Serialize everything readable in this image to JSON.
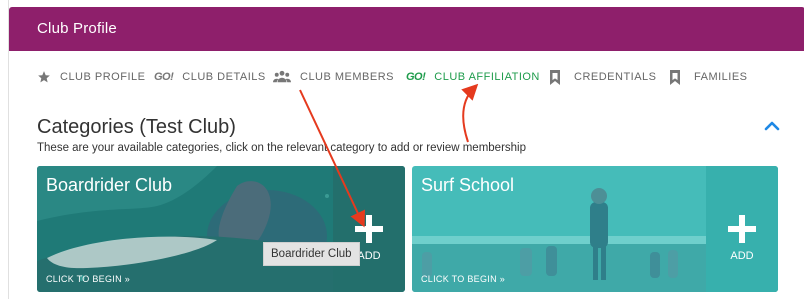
{
  "header": {
    "title": "Club Profile"
  },
  "nav": {
    "items": [
      {
        "label": "CLUB PROFILE",
        "icon": "star-icon"
      },
      {
        "label": "CLUB DETAILS",
        "icon": "go-icon"
      },
      {
        "label": "CLUB MEMBERS",
        "icon": "people-icon"
      },
      {
        "label": "CLUB AFFILIATION",
        "icon": "go-icon",
        "active": true
      },
      {
        "label": "CREDENTIALS",
        "icon": "bookmark-icon"
      },
      {
        "label": "FAMILIES",
        "icon": "bookmark-icon"
      }
    ],
    "go_text": "GO!"
  },
  "section": {
    "title": "Categories (Test Club)",
    "subtitle": "These are your available categories, click on the relevant category to add or review membership"
  },
  "cards": [
    {
      "title": "Boardrider Club",
      "begin": "CLICK TO BEGIN »",
      "add": "ADD",
      "tint": "#1f7a77",
      "pane": "#236f6c"
    },
    {
      "title": "Surf School",
      "begin": "CLICK TO BEGIN »",
      "add": "ADD",
      "tint": "#3fbab8",
      "pane": "#37b0ad"
    }
  ],
  "tooltip": {
    "text": "Boardrider Club"
  },
  "colors": {
    "header": "#8e1f6b",
    "active_nav": "#1f9c4c",
    "accent_blue": "#1e88e5",
    "arrow": "#e53a1e"
  }
}
